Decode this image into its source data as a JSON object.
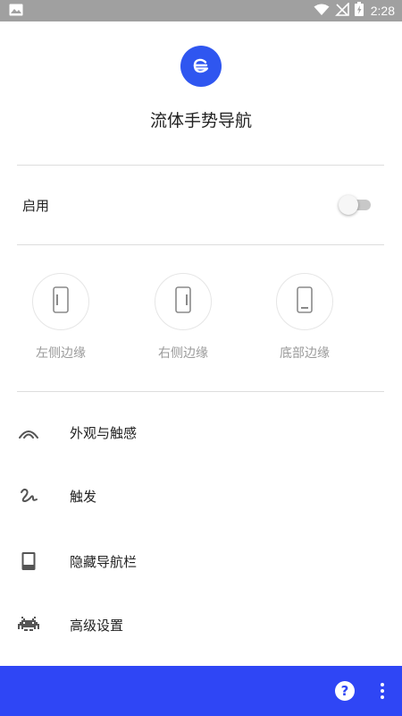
{
  "status_bar": {
    "time": "2:28",
    "icons": [
      "image-notification-icon",
      "wifi-icon",
      "signal-icon",
      "battery-charging-icon"
    ]
  },
  "app": {
    "title": "流体手势导航",
    "logo_icon": "fluid-gesture-logo-icon",
    "accent_color": "#2f56f0"
  },
  "enable": {
    "label": "启用",
    "enabled": false
  },
  "edges": [
    {
      "label": "左侧边缘",
      "icon": "left-edge-phone-icon"
    },
    {
      "label": "右侧边缘",
      "icon": "right-edge-phone-icon"
    },
    {
      "label": "底部边缘",
      "icon": "bottom-edge-phone-icon"
    }
  ],
  "menu": [
    {
      "label": "外观与触感",
      "icon": "arc-icon"
    },
    {
      "label": "触发",
      "icon": "gesture-squiggle-icon"
    },
    {
      "label": "隐藏导航栏",
      "icon": "hide-navbar-icon"
    },
    {
      "label": "高级设置",
      "icon": "space-invader-icon"
    }
  ],
  "bottom_bar": {
    "color": "#2f46f5",
    "help_label": "?",
    "icons": [
      "help-icon",
      "more-vert-icon"
    ]
  }
}
